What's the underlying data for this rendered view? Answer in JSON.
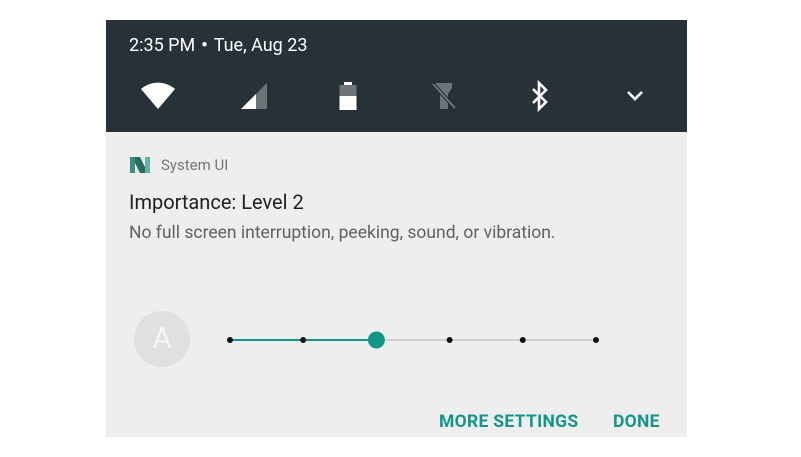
{
  "status": {
    "time": "2:35 PM",
    "separator": "•",
    "date": "Tue, Aug 23"
  },
  "quick_settings": {
    "tiles": [
      {
        "icon": "wifi-icon"
      },
      {
        "icon": "cell-signal-icon"
      },
      {
        "icon": "battery-icon"
      },
      {
        "icon": "flashlight-off-icon"
      },
      {
        "icon": "bluetooth-icon"
      },
      {
        "icon": "chevron-down-icon"
      }
    ]
  },
  "notification": {
    "app_name": "System UI",
    "title": "Importance: Level 2",
    "text": "No full screen interruption, peeking, sound, or vibration.",
    "avatar_letter": "A",
    "importance_slider": {
      "steps": 6,
      "selected_index": 2
    },
    "actions": {
      "more_settings": "MORE SETTINGS",
      "done": "DONE"
    }
  },
  "colors": {
    "header_bg": "#263238",
    "card_bg": "#eeeeee",
    "accent": "#12968a"
  }
}
